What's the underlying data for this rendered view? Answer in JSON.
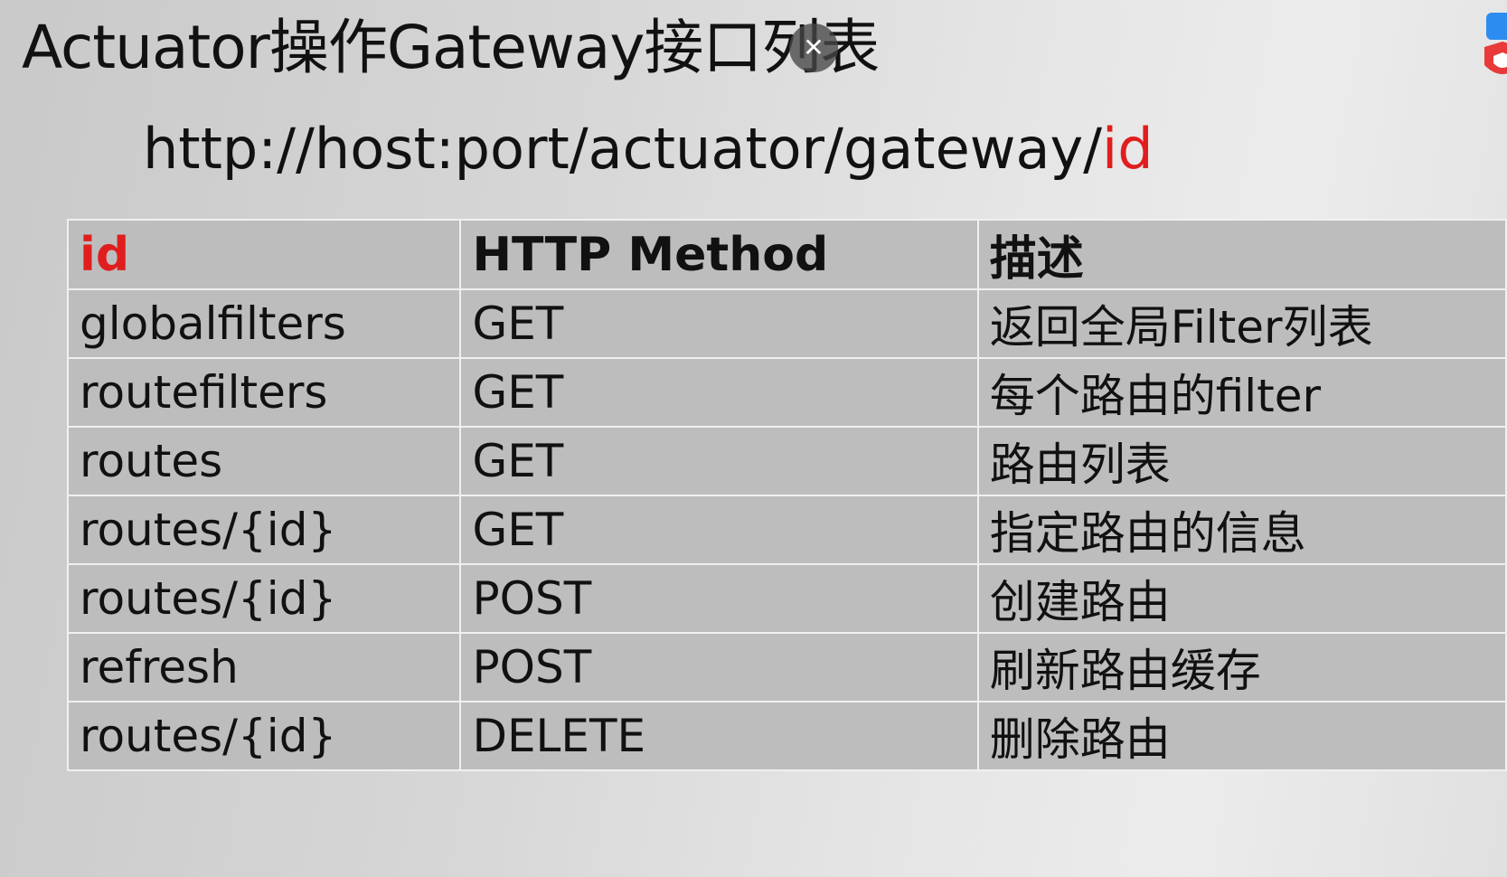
{
  "slide": {
    "title": "Actuator操作Gateway接口列表",
    "url_prefix": "http://host:port/actuator/gateway/",
    "url_suffix": "id",
    "close_icon": "close-icon",
    "accent_color": "#e01e1e"
  },
  "table": {
    "headers": [
      "id",
      "HTTP Method",
      "描述"
    ],
    "rows": [
      [
        "globalfilters",
        "GET",
        "返回全局Filter列表"
      ],
      [
        "routefilters",
        "GET",
        "每个路由的filter"
      ],
      [
        "routes",
        "GET",
        "路由列表"
      ],
      [
        "routes/{id}",
        "GET",
        "指定路由的信息"
      ],
      [
        "routes/{id}",
        "POST",
        "创建路由"
      ],
      [
        "refresh",
        "POST",
        "刷新路由缓存"
      ],
      [
        "routes/{id}",
        "DELETE",
        "删除路由"
      ]
    ]
  }
}
